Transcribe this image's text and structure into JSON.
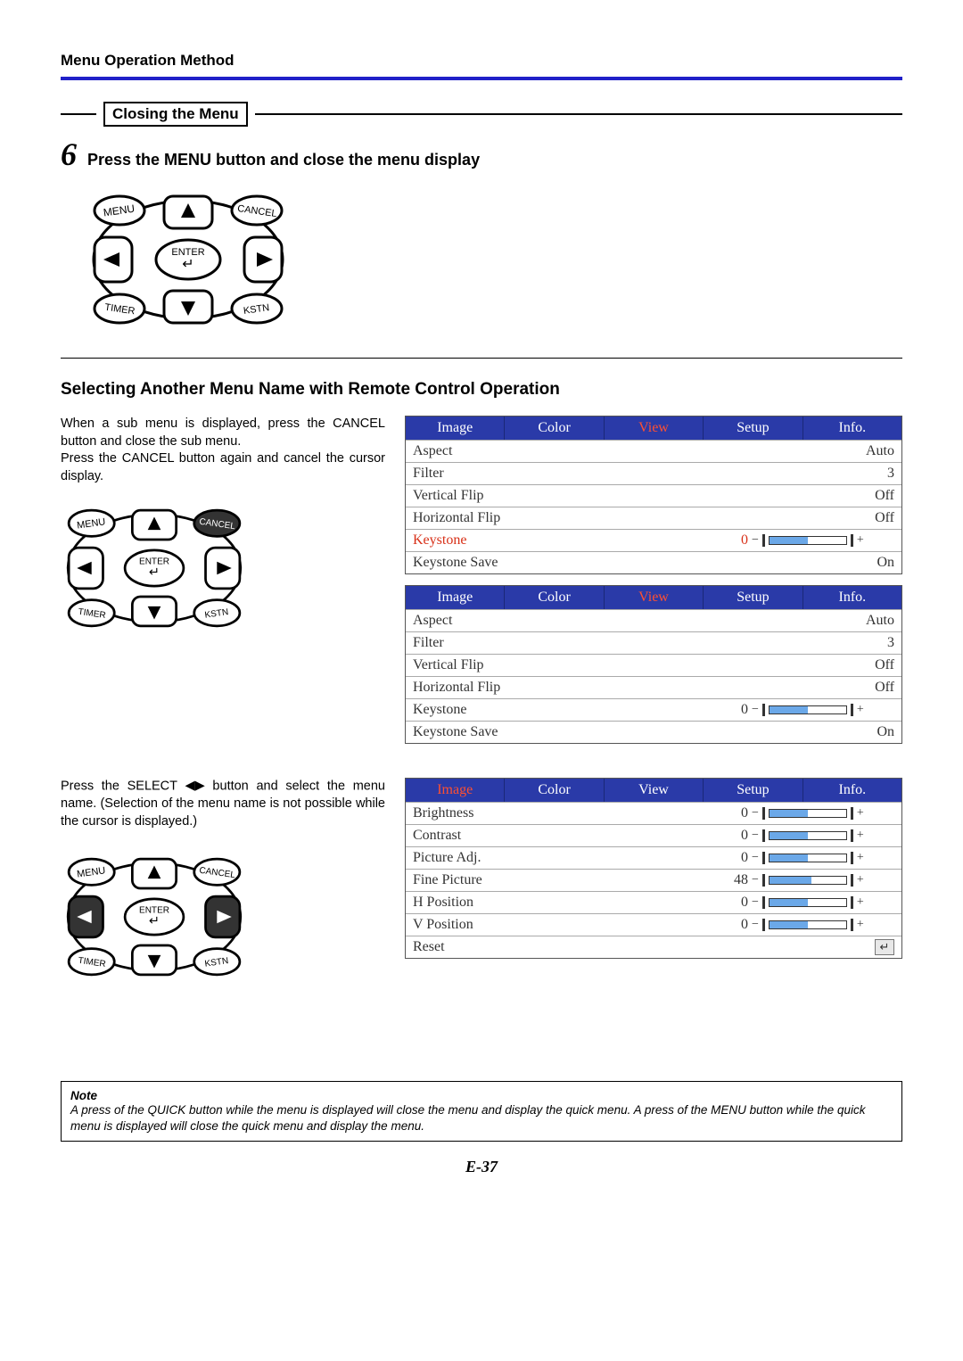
{
  "header": "Menu Operation Method",
  "closing_label": "Closing the Menu",
  "step6": {
    "num": "6",
    "text": "Press the MENU button and close the menu display"
  },
  "remote": {
    "menu": "MENU",
    "cancel": "CANCEL",
    "enter": "ENTER",
    "timer": "TIMER",
    "kstn": "KSTN"
  },
  "section2_head": "Selecting Another Menu Name with Remote Control Operation",
  "para1a": "When a sub menu is displayed, press the CANCEL button and close the sub menu.",
  "para1b": "Press the CANCEL button again and cancel the cursor display.",
  "para2a": "Press the SELECT ",
  "para2b": " button and select the menu name. (Selection of the menu name is not possible while the cursor is displayed.)",
  "tabs": [
    "Image",
    "Color",
    "View",
    "Setup",
    "Info."
  ],
  "view_rows": [
    {
      "label": "Aspect",
      "text": "Auto"
    },
    {
      "label": "Filter",
      "text": "3"
    },
    {
      "label": "Vertical Flip",
      "text": "Off"
    },
    {
      "label": "Horizontal Flip",
      "text": "Off"
    },
    {
      "label": "Keystone",
      "num": "0",
      "slider": 50
    },
    {
      "label": "Keystone Save",
      "text": "On"
    }
  ],
  "image_rows": [
    {
      "label": "Brightness",
      "num": "0",
      "slider": 50
    },
    {
      "label": "Contrast",
      "num": "0",
      "slider": 50
    },
    {
      "label": "Picture Adj.",
      "num": "0",
      "slider": 50
    },
    {
      "label": "Fine Picture",
      "num": "48",
      "slider": 55
    },
    {
      "label": "H Position",
      "num": "0",
      "slider": 50
    },
    {
      "label": "V Position",
      "num": "0",
      "slider": 50
    },
    {
      "label": "Reset",
      "reset": true
    }
  ],
  "note_title": "Note",
  "note_body": "A press of the QUICK button while the menu is displayed will close the menu and display the quick menu. A press of the MENU button while the quick menu is displayed will close the quick menu and display the menu.",
  "page_num": "E-37"
}
